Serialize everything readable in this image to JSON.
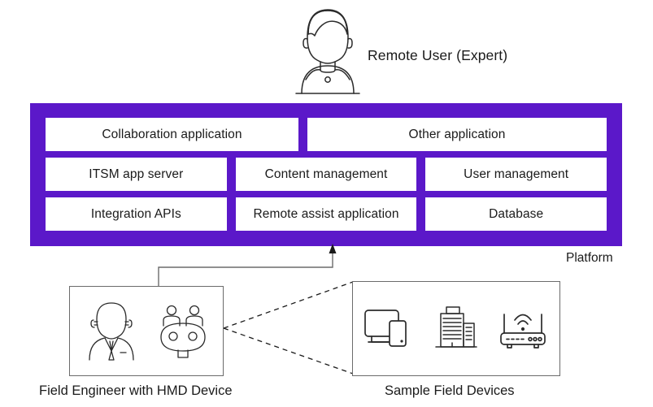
{
  "colors": {
    "platform_purple": "#5B18C9",
    "tile_white": "#ffffff",
    "line_gray": "#6b6b6b",
    "text_dark": "#1a1a1a"
  },
  "actors": {
    "remote_user": {
      "label": "Remote User (Expert)",
      "icon": "person-bust-icon"
    }
  },
  "platform": {
    "label": "Platform",
    "rows": [
      {
        "tiles": [
          {
            "label": "Collaboration application"
          },
          {
            "label": "Other application"
          }
        ]
      },
      {
        "tiles": [
          {
            "label": "ITSM app server"
          },
          {
            "label": "Content management"
          },
          {
            "label": "User management"
          }
        ]
      },
      {
        "tiles": [
          {
            "label": "Integration APIs"
          },
          {
            "label": "Remote assist application"
          },
          {
            "label": "Database"
          }
        ]
      }
    ]
  },
  "field_engineer": {
    "label": "Field Engineer with HMD Device",
    "icons": [
      "businessman-icon",
      "hmd-headset-icon"
    ]
  },
  "field_devices": {
    "label": "Sample Field Devices",
    "icons": [
      "monitor-phone-icon",
      "building-icon",
      "wifi-router-icon"
    ]
  }
}
